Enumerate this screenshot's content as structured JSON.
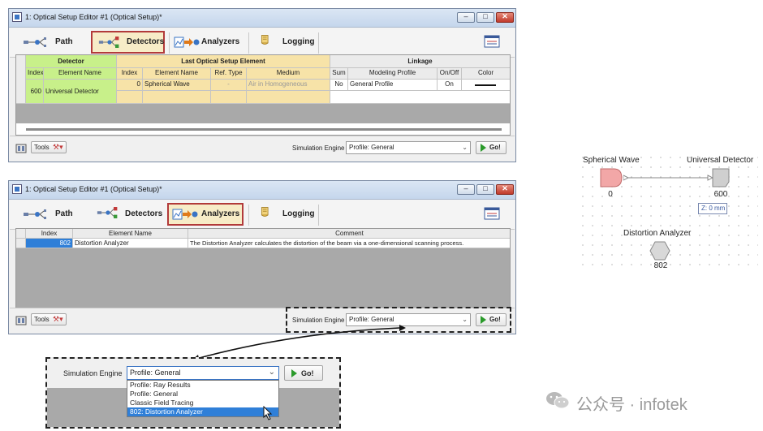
{
  "window1": {
    "title": "1: Optical Setup Editor #1 (Optical Setup)*",
    "tabs": [
      {
        "label": "Path",
        "icon": "path-tree-icon"
      },
      {
        "label": "Detectors",
        "icon": "detectors-icon"
      },
      {
        "label": "Analyzers",
        "icon": "analyzers-icon"
      },
      {
        "label": "Logging",
        "icon": "logging-icon"
      }
    ],
    "groups": {
      "detector": "Detector",
      "last_element": "Last Optical Setup Element",
      "linkage": "Linkage"
    },
    "columns": [
      "Index",
      "Element Name",
      "Index",
      "Element Name",
      "Ref. Type",
      "Medium",
      "Sum",
      "Modeling Profile",
      "On/Off",
      "Color"
    ],
    "row": {
      "detector_index": "600",
      "detector_name": "Universal Detector",
      "elem_index": "0",
      "elem_name": "Spherical Wave",
      "ref_type": "-",
      "medium": "Air in Homogeneous",
      "sum": "No",
      "profile": "General Profile",
      "onoff": "On"
    },
    "footer": {
      "tools": "Tools",
      "engine_label": "Simulation Engine",
      "engine_value": "Profile: General",
      "go": "Go!"
    }
  },
  "window2": {
    "title": "1: Optical Setup Editor #1 (Optical Setup)*",
    "tabs": [
      {
        "label": "Path"
      },
      {
        "label": "Detectors"
      },
      {
        "label": "Analyzers"
      },
      {
        "label": "Logging"
      }
    ],
    "columns": [
      "Index",
      "Element Name",
      "Comment"
    ],
    "row": {
      "index": "802",
      "name": "Distortion Analyzer",
      "comment": "The Distortion Analyzer calculates the distortion of the beam via a one-dimensional scanning process."
    },
    "footer": {
      "tools": "Tools",
      "engine_label": "Simulation Engine",
      "engine_value": "Profile: General",
      "go": "Go!"
    }
  },
  "zoom": {
    "engine_label": "Simulation Engine",
    "engine_value": "Profile: General",
    "go": "Go!",
    "options": [
      "Profile: Ray Results",
      "Profile: General",
      "Classic Field Tracing",
      "802: Distortion Analyzer"
    ],
    "selected_index": 3
  },
  "diagram": {
    "source_label": "Spherical Wave",
    "source_index": "0",
    "detector_label": "Universal Detector",
    "detector_index": "600",
    "detector_z": "Z: 0 mm",
    "analyzer_label": "Distortion Analyzer",
    "analyzer_index": "802",
    "colors": {
      "source": "#f2a7a7",
      "detector": "#cfcfcf",
      "analyzer": "#d8d8d8"
    }
  },
  "watermark": {
    "text": "公众号 · infotek"
  },
  "colors": {
    "active_tab_border": "#b23a3a",
    "detector_group": "#c8f08a",
    "last_element_group": "#f7e3a8",
    "selected_row": "#2f7fd8"
  }
}
